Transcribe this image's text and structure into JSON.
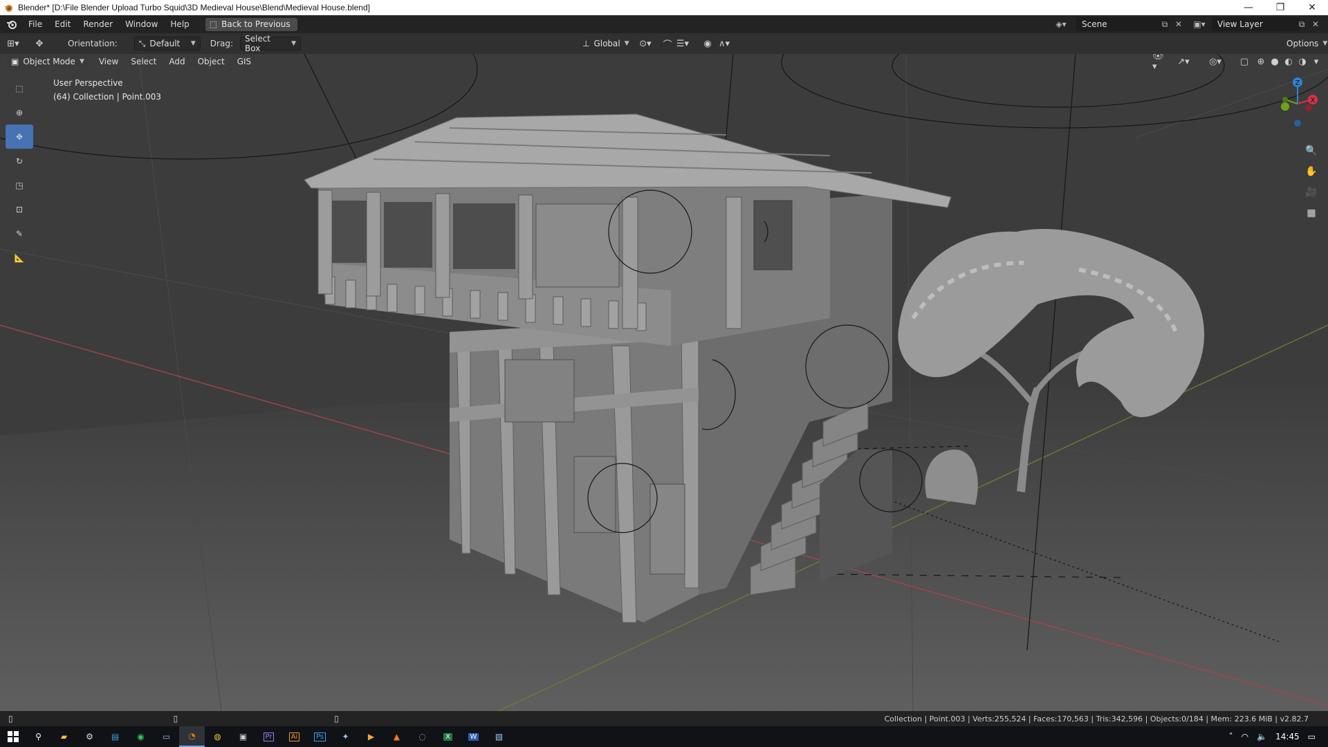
{
  "window": {
    "title": "Blender* [D:\\File Blender Upload Turbo Squid\\3D Medieval House\\Blend\\Medieval House.blend]",
    "controls": [
      "minimize",
      "restore",
      "close"
    ]
  },
  "menubar": {
    "items": [
      "File",
      "Edit",
      "Render",
      "Window",
      "Help"
    ],
    "back_button": "Back to Previous",
    "scene_name": "Scene",
    "view_layer": "View Layer"
  },
  "tool_header": {
    "orientation_label": "Orientation:",
    "orientation_value": "Default",
    "drag_label": "Drag:",
    "drag_value": "Select Box",
    "transform_orientation": "Global",
    "options_label": "Options"
  },
  "viewport_header": {
    "mode": "Object Mode",
    "menus": [
      "View",
      "Select",
      "Add",
      "Object",
      "GIS"
    ]
  },
  "viewport": {
    "perspective_label": "User Perspective",
    "collection_label": "(64) Collection | Point.003",
    "gizmo_axes": [
      "Z",
      "Y",
      "X"
    ],
    "axis_colors": {
      "x": "#d6324a",
      "y": "#6ea317",
      "z": "#2f83d4"
    }
  },
  "toolbar": {
    "tools": [
      "select-box",
      "cursor",
      "move",
      "rotate",
      "scale",
      "transform",
      "annotate",
      "measure"
    ],
    "active": "move"
  },
  "statusbar": {
    "stats": "Collection | Point.003 | Verts:255,524 | Faces:170,563 | Tris:342,596 | Objects:0/184 | Mem: 223.6 MiB | v2.82.7"
  },
  "taskbar": {
    "apps": [
      "start",
      "search",
      "file-explorer",
      "settings",
      "store",
      "whatsapp",
      "app-window",
      "blender",
      "chrome",
      "terminal",
      "premiere",
      "illustrator",
      "photoshop",
      "app-feather",
      "vlc-like",
      "vlc",
      "app-circle",
      "excel",
      "word",
      "app-image"
    ],
    "active": "blender",
    "time": "14:45"
  }
}
